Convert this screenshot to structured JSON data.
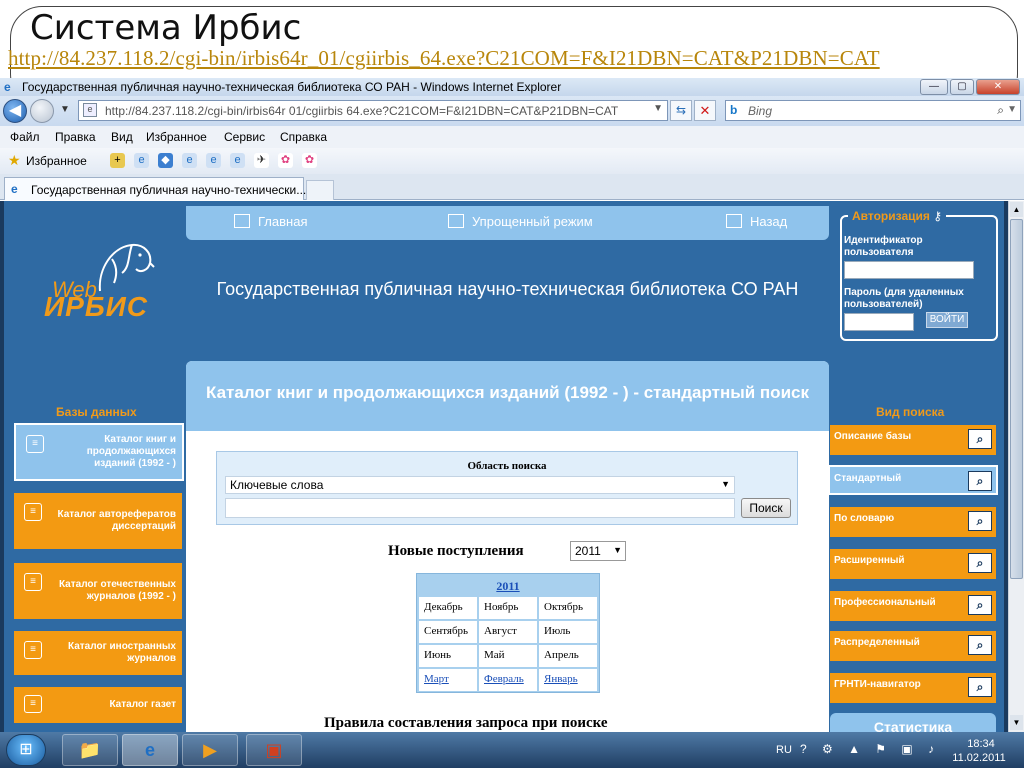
{
  "slide": {
    "title": "Система Ирбис",
    "url": "http://84.237.118.2/cgi-bin/irbis64r_01/cgiirbis_64.exe?C21COM=F&I21DBN=CAT&P21DBN=CAT"
  },
  "window": {
    "title": "Государственная публичная научно-техническая библиотека СО РАН - Windows Internet Explorer",
    "minimize": "—",
    "maximize": "▢",
    "close": "✕"
  },
  "address": {
    "url": "http://84.237.118.2/cgi-bin/irbis64r 01/cgiirbis 64.exe?C21COM=F&I21DBN=CAT&P21DBN=CAT",
    "search_placeholder": "Bing"
  },
  "menu": [
    "Файл",
    "Правка",
    "Вид",
    "Избранное",
    "Сервис",
    "Справка"
  ],
  "favorites": {
    "label": "Избранное"
  },
  "tab": {
    "title": "Государственная публичная научно-технически..."
  },
  "page": {
    "nav": {
      "home": "Главная",
      "simple": "Упрощенный режим",
      "back": "Назад"
    },
    "logo": {
      "web": "Web",
      "irbis": "ИРБИС"
    },
    "library_title": "Государственная публичная научно-техническая библиотека СО РАН",
    "auth": {
      "legend": "Авторизация",
      "id_label": "Идентификатор пользователя",
      "pass_label": "Пароль (для удаленных пользователей)",
      "button": "ВОЙТИ"
    },
    "databases_heading": "Базы данных",
    "search_type_heading": "Вид поиска",
    "databases": [
      "Каталог книг и продолжающихся изданий (1992 - )",
      "Каталог авторефератов диссертаций",
      "Каталог отечественных журналов (1992 - )",
      "Каталог иностранных журналов",
      "Каталог газет"
    ],
    "search_modes": [
      "Описание базы",
      "Стандартный",
      "По словарю",
      "Расширенный",
      "Профессиональный",
      "Распределенный",
      "ГРНТИ-навигатор"
    ],
    "stats_button": "Статистика",
    "catalog_title": "Каталог книг и продолжающихся изданий (1992 - ) - стандартный поиск",
    "search": {
      "area_label": "Область поиска",
      "area_value": "Ключевые слова",
      "query_value": "",
      "button": "Поиск"
    },
    "new_arrivals": {
      "label": "Новые поступления",
      "year": "2011",
      "calendar_year": "2011",
      "months": [
        [
          "Декабрь",
          "Ноябрь",
          "Октябрь"
        ],
        [
          "Сентябрь",
          "Август",
          "Июль"
        ],
        [
          "Июнь",
          "Май",
          "Апрель"
        ],
        [
          "Март",
          "Февраль",
          "Январь"
        ]
      ]
    },
    "rules_heading": "Правила составления запроса при поиске"
  },
  "taskbar": {
    "lang": "RU",
    "time": "18:34",
    "date": "11.02.2011"
  }
}
